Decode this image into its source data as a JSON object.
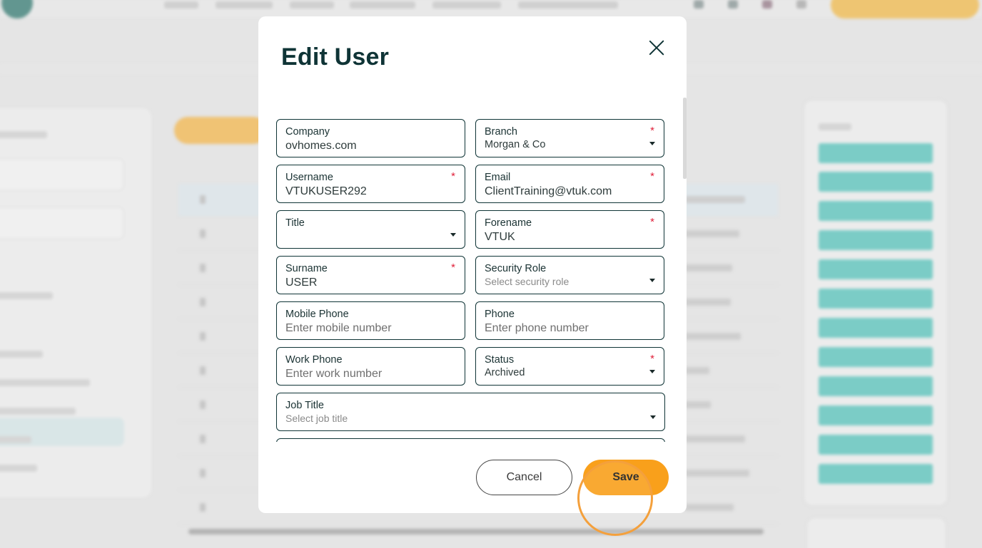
{
  "modal": {
    "title": "Edit User",
    "fields": {
      "company": {
        "label": "Company",
        "value": "ovhomes.com"
      },
      "branch": {
        "label": "Branch",
        "value": "Morgan & Co",
        "required": "*"
      },
      "username": {
        "label": "Username",
        "value": "VTUKUSER292",
        "required": "*"
      },
      "email": {
        "label": "Email",
        "value": "ClientTraining@vtuk.com",
        "required": "*"
      },
      "title": {
        "label": "Title",
        "value": ""
      },
      "forename": {
        "label": "Forename",
        "value": "VTUK",
        "required": "*"
      },
      "surname": {
        "label": "Surname",
        "value": "USER",
        "required": "*"
      },
      "security_role": {
        "label": "Security Role",
        "placeholder": "Select security role"
      },
      "mobile_phone": {
        "label": "Mobile Phone",
        "placeholder": "Enter mobile number"
      },
      "phone": {
        "label": "Phone",
        "placeholder": "Enter phone number"
      },
      "work_phone": {
        "label": "Work Phone",
        "placeholder": "Enter work number"
      },
      "status": {
        "label": "Status",
        "value": "Archived",
        "required": "*"
      },
      "job_title": {
        "label": "Job Title",
        "placeholder": "Select job title"
      }
    },
    "buttons": {
      "cancel": "Cancel",
      "save": "Save"
    }
  },
  "colors": {
    "accent": "#f9a01b",
    "heading": "#0f3436",
    "required": "#e0203a",
    "teal": "#44c0b7"
  }
}
